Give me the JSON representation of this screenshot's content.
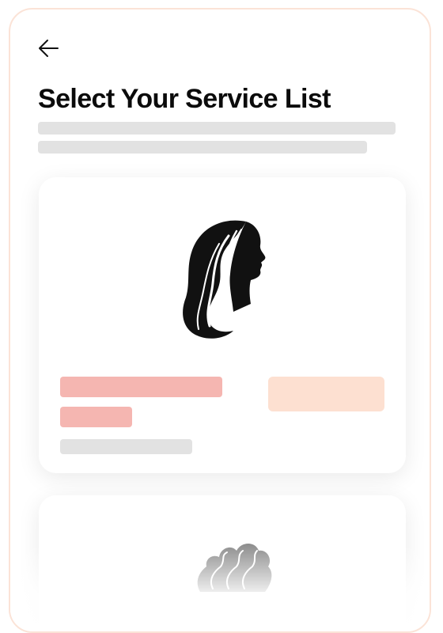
{
  "header": {
    "back_icon": "arrow-left-icon",
    "title": "Select Your Service List"
  },
  "services": [
    {
      "icon": "woman-long-hair-icon"
    },
    {
      "icon": "curly-hair-icon"
    }
  ],
  "colors": {
    "frame_border": "#fbe3d7",
    "skeleton_gray": "#e2e2e2",
    "skeleton_pink": "#f5b6b1",
    "skeleton_peach": "#fde0d1",
    "title_text": "#0b0b0b"
  }
}
